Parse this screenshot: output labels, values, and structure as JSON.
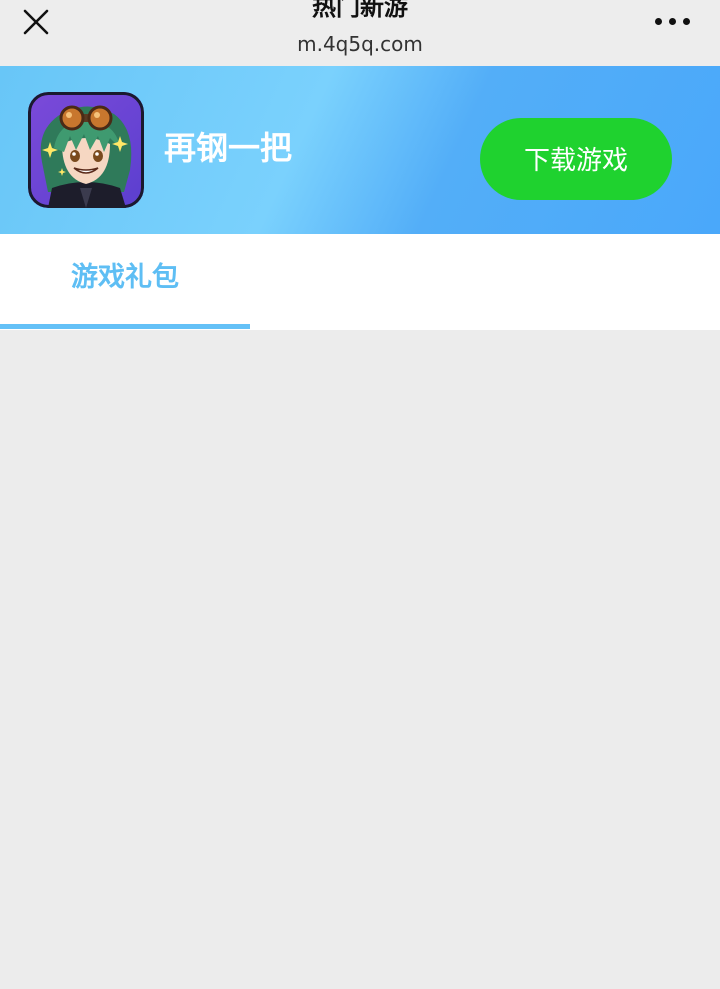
{
  "header": {
    "title": "热门新游",
    "url": "m.4q5q.com",
    "close_icon": "close-icon",
    "more_icon": "more-dots-icon"
  },
  "banner": {
    "app_name": "再钢一把",
    "download_label": "下载游戏",
    "gradient_colors": [
      "#68c6f7",
      "#7ad1fd",
      "#4aa8fa"
    ],
    "button_color": "#1fd22f"
  },
  "tabs": [
    {
      "label": "游戏礼包",
      "active": true
    }
  ],
  "colors": {
    "accent": "#5ebef4",
    "page_background": "#ececec"
  }
}
